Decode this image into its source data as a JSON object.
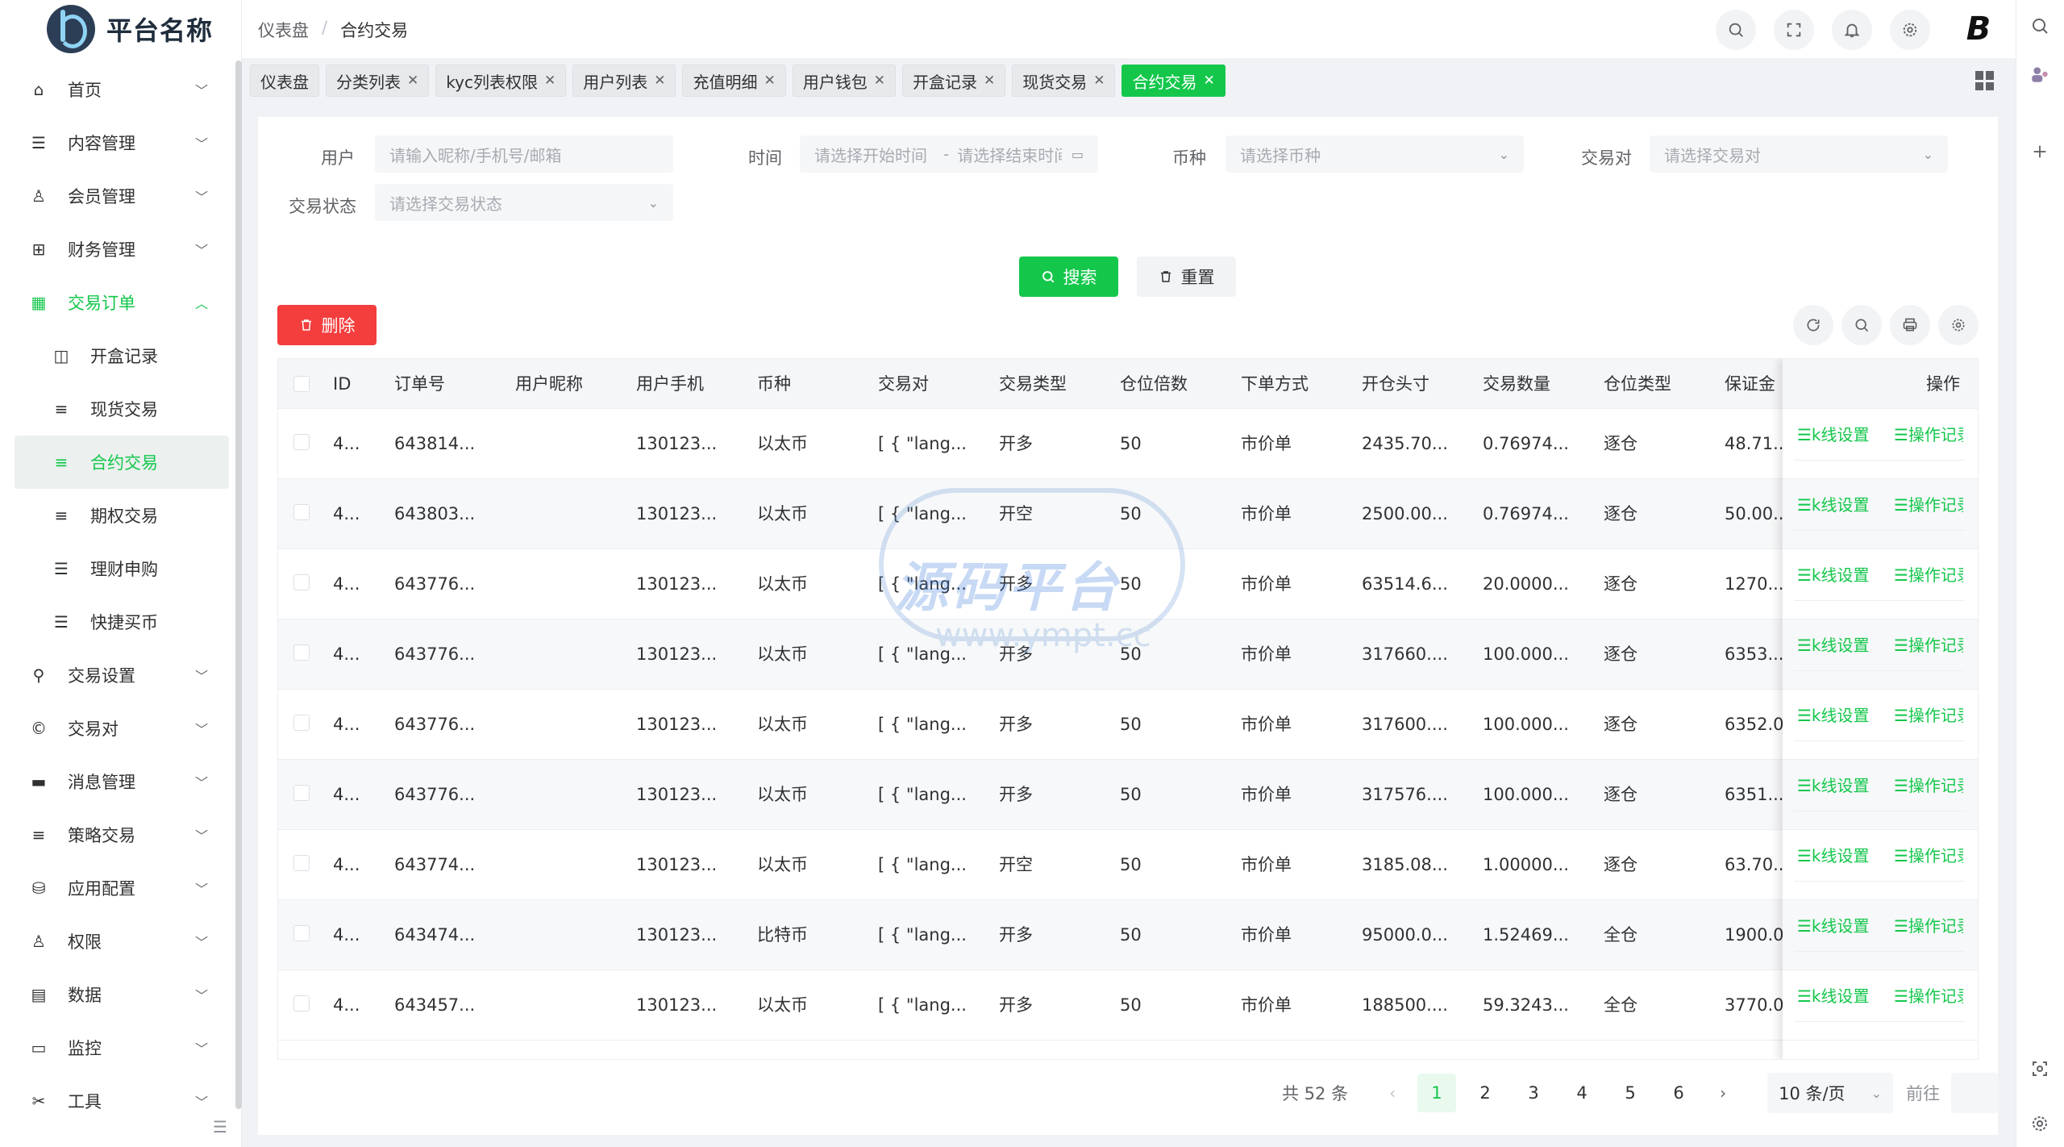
{
  "app": {
    "brand_name": "平台名称"
  },
  "header": {
    "breadcrumb": [
      "仪表盘",
      "合约交易"
    ],
    "breadcrumb_sep": "/"
  },
  "sidebar": {
    "items": [
      {
        "label": "首页",
        "icon": "home-icon"
      },
      {
        "label": "内容管理",
        "icon": "list-icon"
      },
      {
        "label": "会员管理",
        "icon": "user-icon"
      },
      {
        "label": "财务管理",
        "icon": "table-icon"
      },
      {
        "label": "交易订单",
        "icon": "grid-icon",
        "open": true,
        "children": [
          {
            "label": "开盒记录",
            "icon": "box-icon"
          },
          {
            "label": "现货交易",
            "icon": "menu-icon"
          },
          {
            "label": "合约交易",
            "icon": "menu-icon",
            "active": true
          },
          {
            "label": "期权交易",
            "icon": "menu-icon"
          },
          {
            "label": "理财申购",
            "icon": "list-icon"
          },
          {
            "label": "快捷买币",
            "icon": "list-icon"
          }
        ]
      },
      {
        "label": "交易设置",
        "icon": "wrench-icon"
      },
      {
        "label": "交易对",
        "icon": "copyright-icon"
      },
      {
        "label": "消息管理",
        "icon": "message-icon"
      },
      {
        "label": "策略交易",
        "icon": "menu-icon"
      },
      {
        "label": "应用配置",
        "icon": "database-icon"
      },
      {
        "label": "权限",
        "icon": "user-lock-icon"
      },
      {
        "label": "数据",
        "icon": "data-icon"
      },
      {
        "label": "监控",
        "icon": "monitor-icon"
      },
      {
        "label": "工具",
        "icon": "tools-icon"
      }
    ]
  },
  "tags": [
    {
      "label": "仪表盘",
      "closable": false
    },
    {
      "label": "分类列表",
      "closable": true
    },
    {
      "label": "kyc列表权限",
      "closable": true
    },
    {
      "label": "用户列表",
      "closable": true
    },
    {
      "label": "充值明细",
      "closable": true
    },
    {
      "label": "用户钱包",
      "closable": true
    },
    {
      "label": "开盒记录",
      "closable": true
    },
    {
      "label": "现货交易",
      "closable": true
    },
    {
      "label": "合约交易",
      "closable": true,
      "active": true
    }
  ],
  "filters": {
    "user_label": "用户",
    "user_placeholder": "请输入昵称/手机号/邮箱",
    "time_label": "时间",
    "time_start_placeholder": "请选择开始时间",
    "time_sep": "-",
    "time_end_placeholder": "请选择结束时间",
    "coin_label": "币种",
    "coin_placeholder": "请选择币种",
    "pair_label": "交易对",
    "pair_placeholder": "请选择交易对",
    "status_label": "交易状态",
    "status_placeholder": "请选择交易状态",
    "search_label": "搜索",
    "reset_label": "重置",
    "delete_label": "删除"
  },
  "table": {
    "columns": [
      "ID",
      "订单号",
      "用户昵称",
      "用户手机",
      "币种",
      "交易对",
      "交易类型",
      "仓位倍数",
      "下单方式",
      "开仓头寸",
      "交易数量",
      "仓位类型",
      "保证金"
    ],
    "action_header": "操作",
    "action_kline": "☰k线设置",
    "action_op": "☰操作记录",
    "rows": [
      {
        "id": "4...",
        "order": "643814...",
        "nick": "",
        "phone": "130123...",
        "coin": "以太币",
        "pair": "[ { \"lang...",
        "type": "开多",
        "lev": "50",
        "mode": "市价单",
        "pos": "2435.70...",
        "qty": "0.76974...",
        "ptype": "逐仓",
        "margin": "48.71..."
      },
      {
        "id": "4...",
        "order": "643803...",
        "nick": "",
        "phone": "130123...",
        "coin": "以太币",
        "pair": "[ { \"lang...",
        "type": "开空",
        "lev": "50",
        "mode": "市价单",
        "pos": "2500.00...",
        "qty": "0.76974...",
        "ptype": "逐仓",
        "margin": "50.00..."
      },
      {
        "id": "4...",
        "order": "643776...",
        "nick": "",
        "phone": "130123...",
        "coin": "以太币",
        "pair": "[ { \"lang...",
        "type": "开多",
        "lev": "50",
        "mode": "市价单",
        "pos": "63514.6...",
        "qty": "20.0000...",
        "ptype": "逐仓",
        "margin": "1270...."
      },
      {
        "id": "4...",
        "order": "643776...",
        "nick": "",
        "phone": "130123...",
        "coin": "以太币",
        "pair": "[ { \"lang...",
        "type": "开多",
        "lev": "50",
        "mode": "市价单",
        "pos": "317660....",
        "qty": "100.000...",
        "ptype": "逐仓",
        "margin": "6353...."
      },
      {
        "id": "4...",
        "order": "643776...",
        "nick": "",
        "phone": "130123...",
        "coin": "以太币",
        "pair": "[ { \"lang...",
        "type": "开多",
        "lev": "50",
        "mode": "市价单",
        "pos": "317600....",
        "qty": "100.000...",
        "ptype": "逐仓",
        "margin": "6352.0..."
      },
      {
        "id": "4...",
        "order": "643776...",
        "nick": "",
        "phone": "130123...",
        "coin": "以太币",
        "pair": "[ { \"lang...",
        "type": "开多",
        "lev": "50",
        "mode": "市价单",
        "pos": "317576....",
        "qty": "100.000...",
        "ptype": "逐仓",
        "margin": "6351...."
      },
      {
        "id": "4...",
        "order": "643774...",
        "nick": "",
        "phone": "130123...",
        "coin": "以太币",
        "pair": "[ { \"lang...",
        "type": "开空",
        "lev": "50",
        "mode": "市价单",
        "pos": "3185.08...",
        "qty": "1.00000...",
        "ptype": "逐仓",
        "margin": "63.70..."
      },
      {
        "id": "4...",
        "order": "643474...",
        "nick": "",
        "phone": "130123...",
        "coin": "比特币",
        "pair": "[ { \"lang...",
        "type": "开多",
        "lev": "50",
        "mode": "市价单",
        "pos": "95000.0...",
        "qty": "1.52469...",
        "ptype": "全仓",
        "margin": "1900.0..."
      },
      {
        "id": "4...",
        "order": "643457...",
        "nick": "",
        "phone": "130123...",
        "coin": "以太币",
        "pair": "[ { \"lang...",
        "type": "开多",
        "lev": "50",
        "mode": "市价单",
        "pos": "188500....",
        "qty": "59.3243...",
        "ptype": "全仓",
        "margin": "3770.0..."
      }
    ]
  },
  "pagination": {
    "total": "共 52 条",
    "pages": [
      "1",
      "2",
      "3",
      "4",
      "5",
      "6"
    ],
    "current": "1",
    "page_size": "10 条/页",
    "goto_label": "前往"
  },
  "watermark": {
    "text": "源码平台",
    "url": "www.ympt.cc"
  },
  "colors": {
    "accent": "#14c74b",
    "danger": "#f43d3d"
  }
}
